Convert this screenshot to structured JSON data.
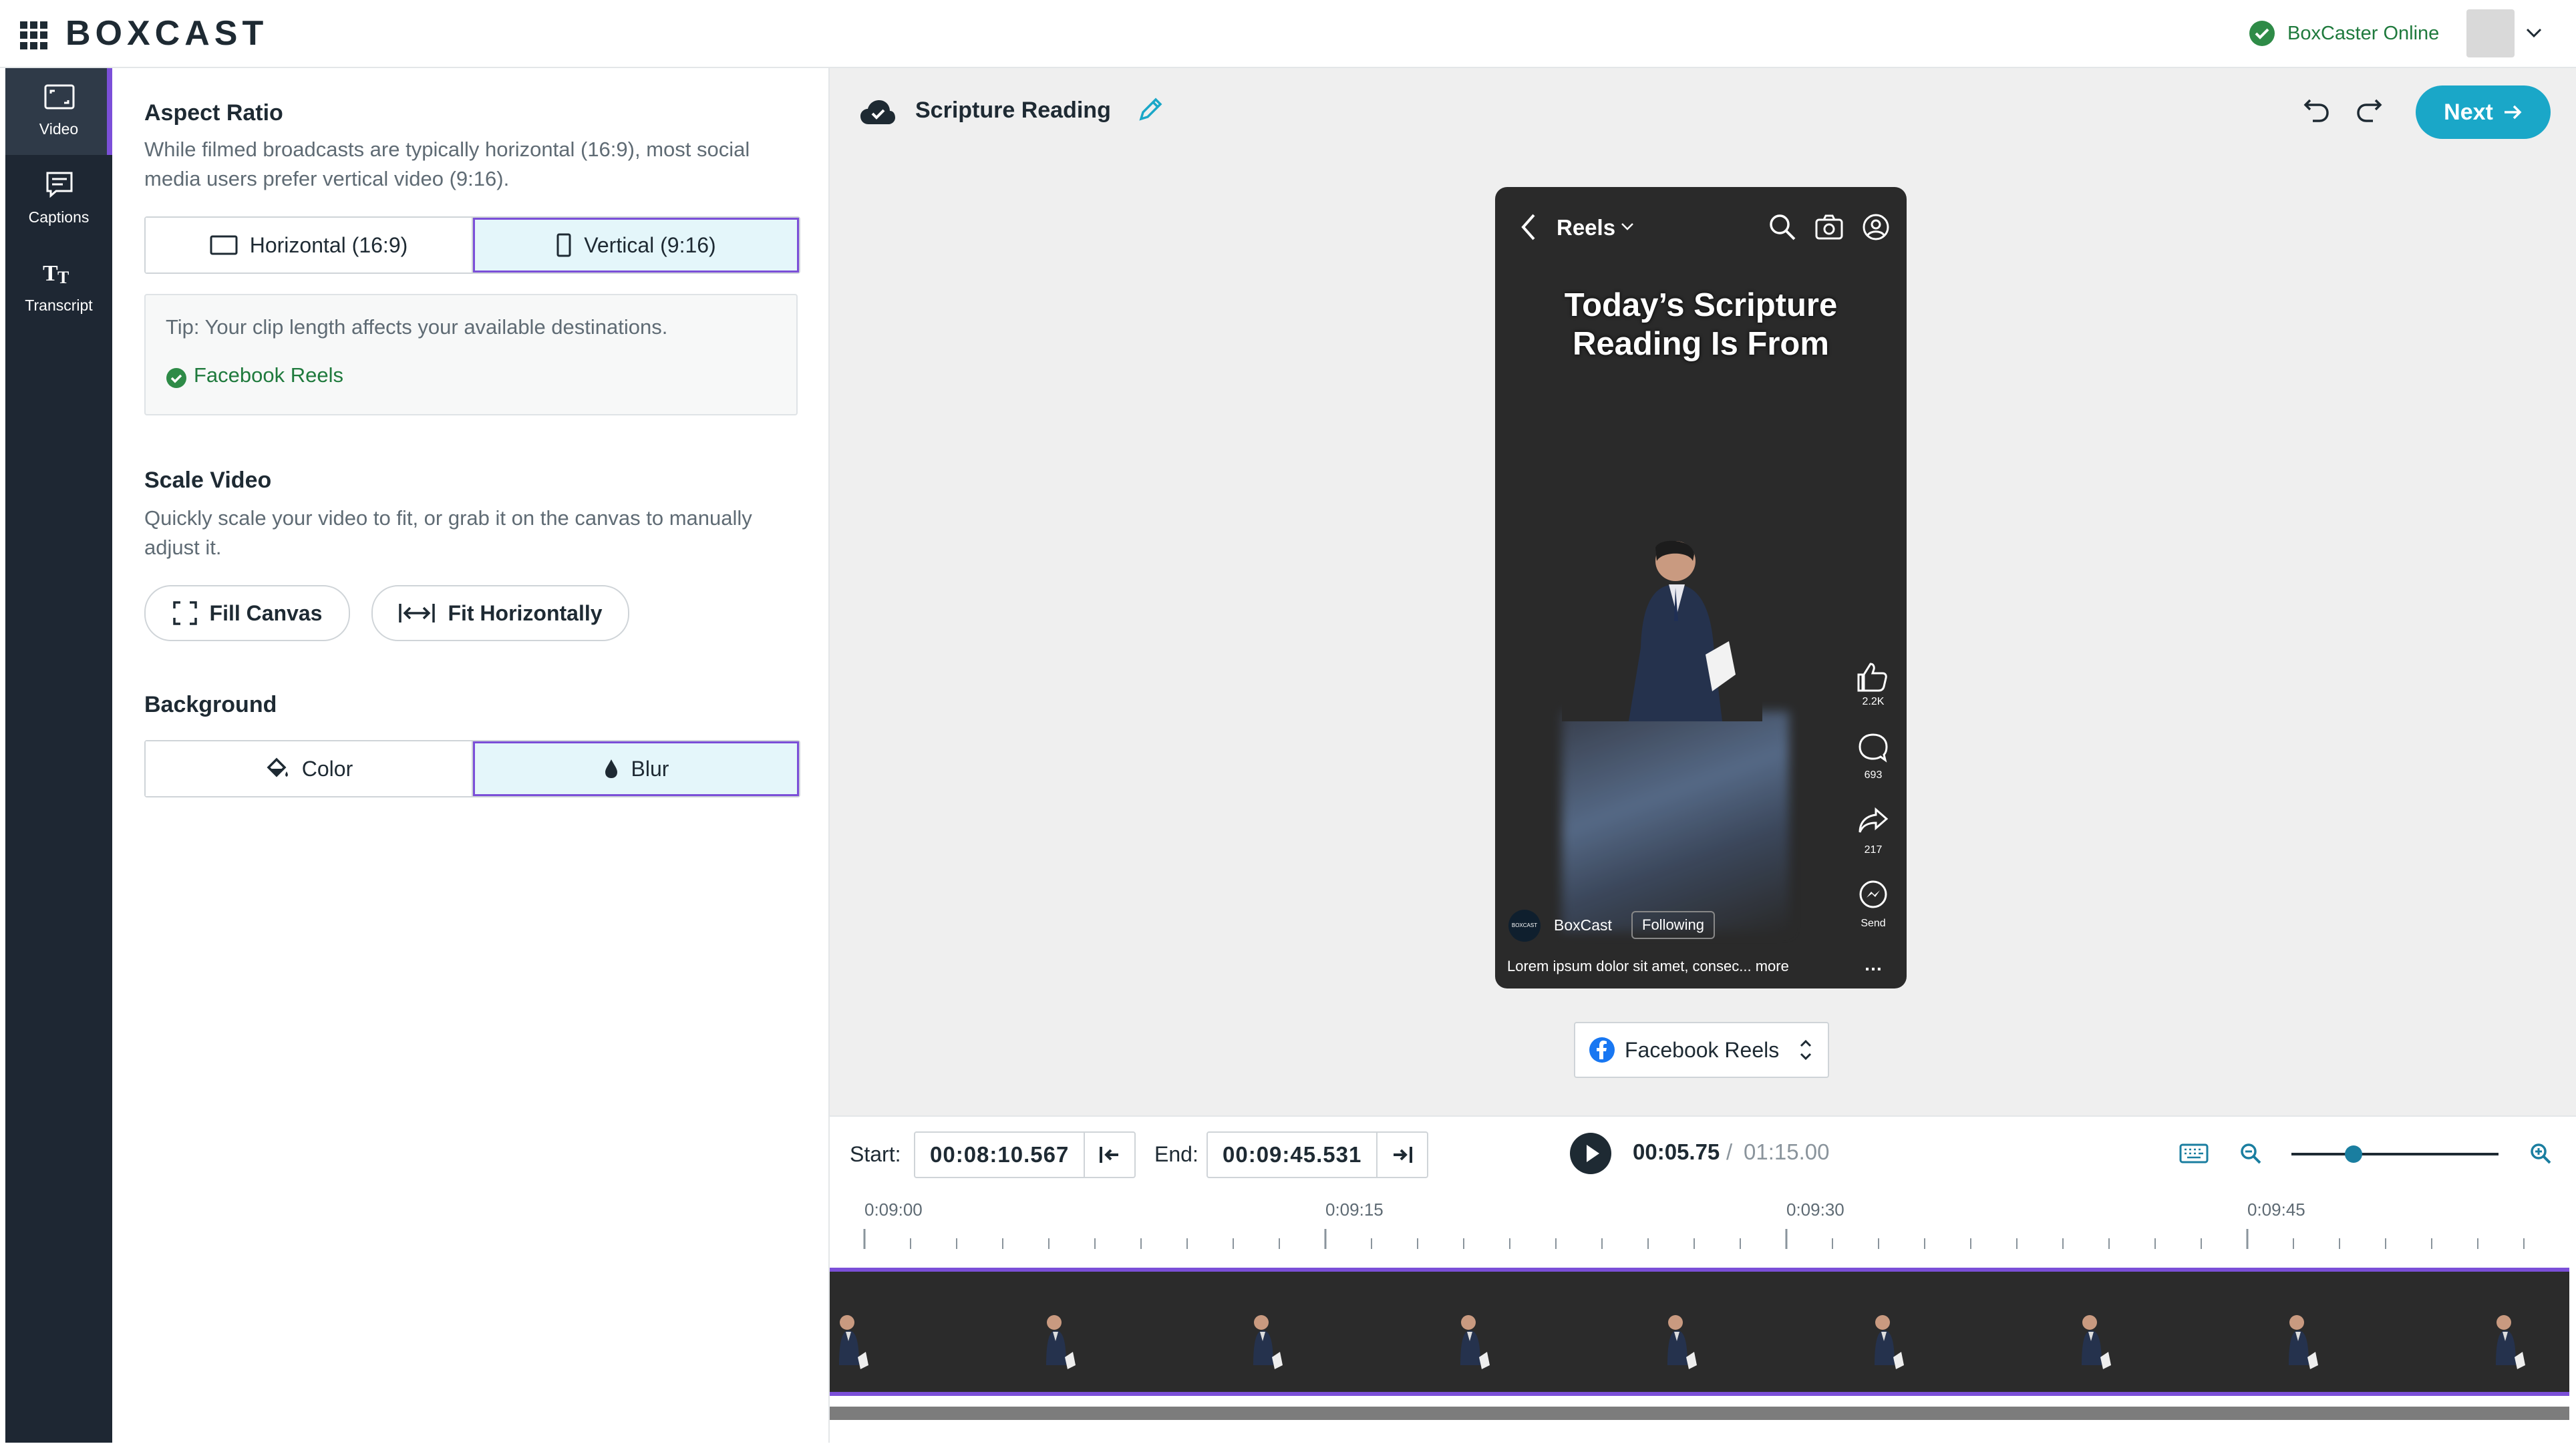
{
  "header": {
    "logo": "BOXCAST",
    "status": "BoxCaster Online",
    "status_color": "#1f7a3d"
  },
  "rail": {
    "items": [
      {
        "label": "Video",
        "icon": "video-frame-icon"
      },
      {
        "label": "Captions",
        "icon": "captions-icon"
      },
      {
        "label": "Transcript",
        "icon": "text-size-icon"
      }
    ]
  },
  "panel": {
    "aspect": {
      "title": "Aspect Ratio",
      "desc": "While filmed broadcasts are typically horizontal (16:9), most social media users prefer vertical video (9:16).",
      "horizontal": "Horizontal (16:9)",
      "vertical": "Vertical (9:16)",
      "selected": "vertical"
    },
    "tip": {
      "text": "Tip: Your clip length affects your available destinations.",
      "destination": "Facebook Reels"
    },
    "scale": {
      "title": "Scale Video",
      "desc": "Quickly scale your video to fit, or grab it on the canvas to manually adjust it.",
      "fill": "Fill Canvas",
      "fit": "Fit Horizontally"
    },
    "background": {
      "title": "Background",
      "color": "Color",
      "blur": "Blur",
      "selected": "blur"
    }
  },
  "editor": {
    "project_title": "Scripture Reading",
    "next_label": "Next",
    "accent": "#1aa7c8",
    "selection_accent": "#7b4fd8"
  },
  "preview": {
    "tab": "Reels",
    "headline": "Today’s Scripture Reading Is From",
    "likes": "2.2K",
    "comments": "693",
    "shares": "217",
    "send": "Send",
    "account": "BoxCast",
    "account_badge": "BOXCAST",
    "follow": "Following",
    "caption": "Lorem ipsum dolor sit amet, consec... more"
  },
  "destination_select": "Facebook Reels",
  "timeline": {
    "start_label": "Start:",
    "start_value": "00:08:10.567",
    "end_label": "End:",
    "end_value": "00:09:45.531",
    "current": "00:05.75",
    "separator": "/",
    "total": "01:15.00",
    "ruler": [
      "0:09:00",
      "0:09:15",
      "0:09:30",
      "0:09:45"
    ],
    "zoom_fraction": 0.3
  }
}
